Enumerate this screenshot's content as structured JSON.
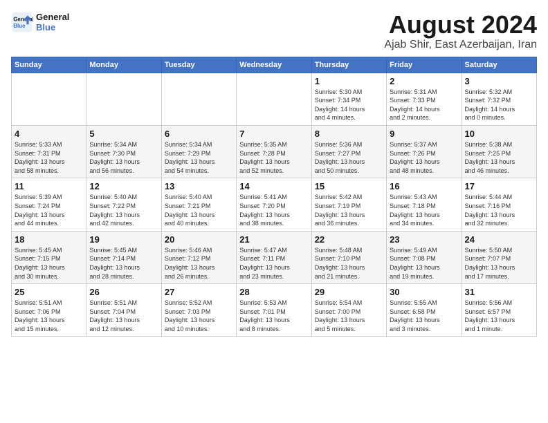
{
  "logo": {
    "text_general": "General",
    "text_blue": "Blue"
  },
  "title": "August 2024",
  "subtitle": "Ajab Shir, East Azerbaijan, Iran",
  "days_of_week": [
    "Sunday",
    "Monday",
    "Tuesday",
    "Wednesday",
    "Thursday",
    "Friday",
    "Saturday"
  ],
  "weeks": [
    [
      {
        "day": "",
        "info": ""
      },
      {
        "day": "",
        "info": ""
      },
      {
        "day": "",
        "info": ""
      },
      {
        "day": "",
        "info": ""
      },
      {
        "day": "1",
        "info": "Sunrise: 5:30 AM\nSunset: 7:34 PM\nDaylight: 14 hours\nand 4 minutes."
      },
      {
        "day": "2",
        "info": "Sunrise: 5:31 AM\nSunset: 7:33 PM\nDaylight: 14 hours\nand 2 minutes."
      },
      {
        "day": "3",
        "info": "Sunrise: 5:32 AM\nSunset: 7:32 PM\nDaylight: 14 hours\nand 0 minutes."
      }
    ],
    [
      {
        "day": "4",
        "info": "Sunrise: 5:33 AM\nSunset: 7:31 PM\nDaylight: 13 hours\nand 58 minutes."
      },
      {
        "day": "5",
        "info": "Sunrise: 5:34 AM\nSunset: 7:30 PM\nDaylight: 13 hours\nand 56 minutes."
      },
      {
        "day": "6",
        "info": "Sunrise: 5:34 AM\nSunset: 7:29 PM\nDaylight: 13 hours\nand 54 minutes."
      },
      {
        "day": "7",
        "info": "Sunrise: 5:35 AM\nSunset: 7:28 PM\nDaylight: 13 hours\nand 52 minutes."
      },
      {
        "day": "8",
        "info": "Sunrise: 5:36 AM\nSunset: 7:27 PM\nDaylight: 13 hours\nand 50 minutes."
      },
      {
        "day": "9",
        "info": "Sunrise: 5:37 AM\nSunset: 7:26 PM\nDaylight: 13 hours\nand 48 minutes."
      },
      {
        "day": "10",
        "info": "Sunrise: 5:38 AM\nSunset: 7:25 PM\nDaylight: 13 hours\nand 46 minutes."
      }
    ],
    [
      {
        "day": "11",
        "info": "Sunrise: 5:39 AM\nSunset: 7:24 PM\nDaylight: 13 hours\nand 44 minutes."
      },
      {
        "day": "12",
        "info": "Sunrise: 5:40 AM\nSunset: 7:22 PM\nDaylight: 13 hours\nand 42 minutes."
      },
      {
        "day": "13",
        "info": "Sunrise: 5:40 AM\nSunset: 7:21 PM\nDaylight: 13 hours\nand 40 minutes."
      },
      {
        "day": "14",
        "info": "Sunrise: 5:41 AM\nSunset: 7:20 PM\nDaylight: 13 hours\nand 38 minutes."
      },
      {
        "day": "15",
        "info": "Sunrise: 5:42 AM\nSunset: 7:19 PM\nDaylight: 13 hours\nand 36 minutes."
      },
      {
        "day": "16",
        "info": "Sunrise: 5:43 AM\nSunset: 7:18 PM\nDaylight: 13 hours\nand 34 minutes."
      },
      {
        "day": "17",
        "info": "Sunrise: 5:44 AM\nSunset: 7:16 PM\nDaylight: 13 hours\nand 32 minutes."
      }
    ],
    [
      {
        "day": "18",
        "info": "Sunrise: 5:45 AM\nSunset: 7:15 PM\nDaylight: 13 hours\nand 30 minutes."
      },
      {
        "day": "19",
        "info": "Sunrise: 5:45 AM\nSunset: 7:14 PM\nDaylight: 13 hours\nand 28 minutes."
      },
      {
        "day": "20",
        "info": "Sunrise: 5:46 AM\nSunset: 7:12 PM\nDaylight: 13 hours\nand 26 minutes."
      },
      {
        "day": "21",
        "info": "Sunrise: 5:47 AM\nSunset: 7:11 PM\nDaylight: 13 hours\nand 23 minutes."
      },
      {
        "day": "22",
        "info": "Sunrise: 5:48 AM\nSunset: 7:10 PM\nDaylight: 13 hours\nand 21 minutes."
      },
      {
        "day": "23",
        "info": "Sunrise: 5:49 AM\nSunset: 7:08 PM\nDaylight: 13 hours\nand 19 minutes."
      },
      {
        "day": "24",
        "info": "Sunrise: 5:50 AM\nSunset: 7:07 PM\nDaylight: 13 hours\nand 17 minutes."
      }
    ],
    [
      {
        "day": "25",
        "info": "Sunrise: 5:51 AM\nSunset: 7:06 PM\nDaylight: 13 hours\nand 15 minutes."
      },
      {
        "day": "26",
        "info": "Sunrise: 5:51 AM\nSunset: 7:04 PM\nDaylight: 13 hours\nand 12 minutes."
      },
      {
        "day": "27",
        "info": "Sunrise: 5:52 AM\nSunset: 7:03 PM\nDaylight: 13 hours\nand 10 minutes."
      },
      {
        "day": "28",
        "info": "Sunrise: 5:53 AM\nSunset: 7:01 PM\nDaylight: 13 hours\nand 8 minutes."
      },
      {
        "day": "29",
        "info": "Sunrise: 5:54 AM\nSunset: 7:00 PM\nDaylight: 13 hours\nand 5 minutes."
      },
      {
        "day": "30",
        "info": "Sunrise: 5:55 AM\nSunset: 6:58 PM\nDaylight: 13 hours\nand 3 minutes."
      },
      {
        "day": "31",
        "info": "Sunrise: 5:56 AM\nSunset: 6:57 PM\nDaylight: 13 hours\nand 1 minute."
      }
    ]
  ]
}
